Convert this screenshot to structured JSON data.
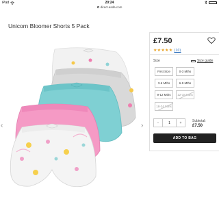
{
  "status_bar": {
    "carrier": "iPad",
    "time": "20:24",
    "wifi_icon": "wifi-icon",
    "bluetooth_icon": "bluetooth-icon",
    "battery_icon": "battery-icon"
  },
  "address_bar": {
    "url": "direct.asda.com"
  },
  "product": {
    "title": "Unicorn Bloomer Shorts 5 Pack",
    "price": "£7.50",
    "rating_stars": "★★★★★",
    "rating_count": "(10)",
    "rating_value": 5,
    "image_description_icon": "product-photo",
    "colors": {
      "accent_star": "#e8a020",
      "button_bg": "#222222"
    }
  },
  "size_selector": {
    "label": "Size",
    "guide_label": "Size guide",
    "sizes": [
      {
        "label": "First Size",
        "available": true
      },
      {
        "label": "0-3 Mths",
        "available": true
      },
      {
        "label": "3-6 Mths",
        "available": true
      },
      {
        "label": "6-9 Mths",
        "available": true
      },
      {
        "label": "9-12 Mths",
        "available": true
      },
      {
        "label": "12-18 Mths",
        "available": false
      },
      {
        "label": "18-24 Mths",
        "available": false
      }
    ]
  },
  "purchase": {
    "quantity_minus": "−",
    "quantity": "1",
    "quantity_plus": "+",
    "subtotal_label": "Subtotal:",
    "subtotal_value": "£7.50",
    "add_to_bag_label": "ADD TO BAG"
  },
  "carousel": {
    "prev": "‹",
    "next": "›"
  }
}
